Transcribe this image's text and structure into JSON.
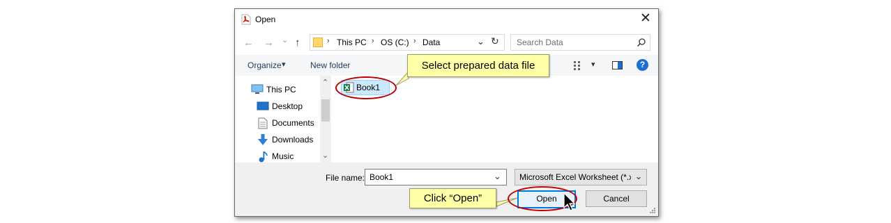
{
  "dialog": {
    "title": "Open",
    "close_glyph": "✕",
    "nav": {
      "back": "←",
      "forward": "→",
      "recent": "⌄",
      "up": "↑"
    },
    "address": {
      "crumbs": [
        "This PC",
        "OS (C:)",
        "Data"
      ],
      "separators": [
        "›",
        "›",
        "›"
      ],
      "dropdown": "⌄",
      "refresh": "↻"
    },
    "search": {
      "placeholder": "Search Data"
    },
    "toolbar": {
      "organize": "Organize",
      "organize_caret": "▾",
      "new_folder": "New folder",
      "view_caret": "▾",
      "help": "?"
    },
    "tree": {
      "items": [
        {
          "label": "This PC",
          "icon": "monitor-icon"
        },
        {
          "label": "Desktop",
          "icon": "desktop-icon"
        },
        {
          "label": "Documents",
          "icon": "documents-icon"
        },
        {
          "label": "Downloads",
          "icon": "downloads-icon"
        },
        {
          "label": "Music",
          "icon": "music-icon"
        }
      ],
      "scroll_up": "⌃",
      "scroll_down": "⌄"
    },
    "files": [
      {
        "name": "Book1",
        "icon": "excel-file-icon"
      }
    ],
    "filename": {
      "label": "File name:",
      "value": "Book1",
      "dropdown": "⌄"
    },
    "filetype": {
      "value": "Microsoft Excel Worksheet (*.xlsx)",
      "dropdown": "⌄"
    },
    "buttons": {
      "open": "Open",
      "cancel": "Cancel"
    }
  },
  "annotations": {
    "select_callout": "Select prepared data file",
    "open_callout": "Click “Open”"
  },
  "colors": {
    "highlight_ring": "#c00000",
    "callout_bg": "#ffffa8",
    "accent": "#0078d7",
    "help_blue": "#1a6fd1"
  }
}
